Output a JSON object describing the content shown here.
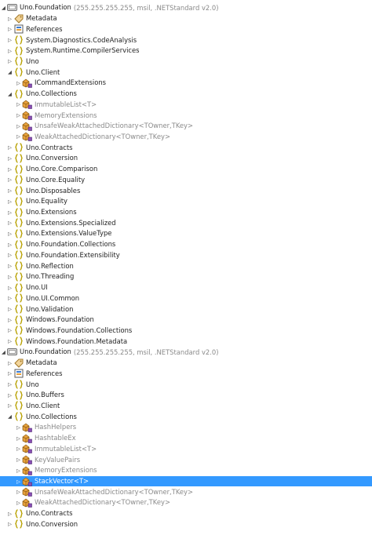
{
  "tree": [
    {
      "depth": 0,
      "expanded": true,
      "icon": "assembly-icon",
      "label": "Uno.Foundation",
      "sub": "(255.255.255.255, msil, .NETStandard v2.0)",
      "name": "assembly-uno-foundation"
    },
    {
      "depth": 1,
      "expanded": false,
      "icon": "metadata-icon",
      "label": "Metadata",
      "name": "node-metadata"
    },
    {
      "depth": 1,
      "expanded": false,
      "icon": "references-icon",
      "label": "References",
      "name": "node-references"
    },
    {
      "depth": 1,
      "expanded": false,
      "icon": "namespace-icon",
      "label": "System.Diagnostics.CodeAnalysis",
      "name": "ns-system-diagnostics-codeanalysis"
    },
    {
      "depth": 1,
      "expanded": false,
      "icon": "namespace-icon",
      "label": "System.Runtime.CompilerServices",
      "name": "ns-system-runtime-compilerservices"
    },
    {
      "depth": 1,
      "expanded": false,
      "icon": "namespace-icon",
      "label": "Uno",
      "name": "ns-uno"
    },
    {
      "depth": 1,
      "expanded": true,
      "icon": "namespace-icon",
      "label": "Uno.Client",
      "name": "ns-uno-client"
    },
    {
      "depth": 2,
      "expanded": false,
      "icon": "class-icon",
      "label": "ICommandExtensions",
      "name": "type-icommandextensions"
    },
    {
      "depth": 1,
      "expanded": true,
      "icon": "namespace-icon",
      "label": "Uno.Collections",
      "name": "ns-uno-collections"
    },
    {
      "depth": 2,
      "expanded": false,
      "icon": "class-icon",
      "label": "ImmutableList<T>",
      "gray": true,
      "name": "type-immutablelist"
    },
    {
      "depth": 2,
      "expanded": false,
      "icon": "class-icon",
      "label": "MemoryExtensions",
      "gray": true,
      "name": "type-memoryextensions"
    },
    {
      "depth": 2,
      "expanded": false,
      "icon": "class-icon",
      "label": "UnsafeWeakAttachedDictionary<TOwner,TKey>",
      "gray": true,
      "name": "type-unsafeweakattacheddictionary"
    },
    {
      "depth": 2,
      "expanded": false,
      "icon": "class-icon",
      "label": "WeakAttachedDictionary<TOwner,TKey>",
      "gray": true,
      "name": "type-weakattacheddictionary"
    },
    {
      "depth": 1,
      "expanded": false,
      "icon": "namespace-icon",
      "label": "Uno.Contracts",
      "name": "ns-uno-contracts"
    },
    {
      "depth": 1,
      "expanded": false,
      "icon": "namespace-icon",
      "label": "Uno.Conversion",
      "name": "ns-uno-conversion"
    },
    {
      "depth": 1,
      "expanded": false,
      "icon": "namespace-icon",
      "label": "Uno.Core.Comparison",
      "name": "ns-uno-core-comparison"
    },
    {
      "depth": 1,
      "expanded": false,
      "icon": "namespace-icon",
      "label": "Uno.Core.Equality",
      "name": "ns-uno-core-equality"
    },
    {
      "depth": 1,
      "expanded": false,
      "icon": "namespace-icon",
      "label": "Uno.Disposables",
      "name": "ns-uno-disposables"
    },
    {
      "depth": 1,
      "expanded": false,
      "icon": "namespace-icon",
      "label": "Uno.Equality",
      "name": "ns-uno-equality"
    },
    {
      "depth": 1,
      "expanded": false,
      "icon": "namespace-icon",
      "label": "Uno.Extensions",
      "name": "ns-uno-extensions"
    },
    {
      "depth": 1,
      "expanded": false,
      "icon": "namespace-icon",
      "label": "Uno.Extensions.Specialized",
      "name": "ns-uno-extensions-specialized"
    },
    {
      "depth": 1,
      "expanded": false,
      "icon": "namespace-icon",
      "label": "Uno.Extensions.ValueType",
      "name": "ns-uno-extensions-valuetype"
    },
    {
      "depth": 1,
      "expanded": false,
      "icon": "namespace-icon",
      "label": "Uno.Foundation.Collections",
      "name": "ns-uno-foundation-collections"
    },
    {
      "depth": 1,
      "expanded": false,
      "icon": "namespace-icon",
      "label": "Uno.Foundation.Extensibility",
      "name": "ns-uno-foundation-extensibility"
    },
    {
      "depth": 1,
      "expanded": false,
      "icon": "namespace-icon",
      "label": "Uno.Reflection",
      "name": "ns-uno-reflection"
    },
    {
      "depth": 1,
      "expanded": false,
      "icon": "namespace-icon",
      "label": "Uno.Threading",
      "name": "ns-uno-threading"
    },
    {
      "depth": 1,
      "expanded": false,
      "icon": "namespace-icon",
      "label": "Uno.UI",
      "name": "ns-uno-ui"
    },
    {
      "depth": 1,
      "expanded": false,
      "icon": "namespace-icon",
      "label": "Uno.UI.Common",
      "name": "ns-uno-ui-common"
    },
    {
      "depth": 1,
      "expanded": false,
      "icon": "namespace-icon",
      "label": "Uno.Validation",
      "name": "ns-uno-validation"
    },
    {
      "depth": 1,
      "expanded": false,
      "icon": "namespace-icon",
      "label": "Windows.Foundation",
      "name": "ns-windows-foundation"
    },
    {
      "depth": 1,
      "expanded": false,
      "icon": "namespace-icon",
      "label": "Windows.Foundation.Collections",
      "name": "ns-windows-foundation-collections"
    },
    {
      "depth": 1,
      "expanded": false,
      "icon": "namespace-icon",
      "label": "Windows.Foundation.Metadata",
      "name": "ns-windows-foundation-metadata"
    },
    {
      "depth": 0,
      "expanded": true,
      "icon": "assembly-icon",
      "label": "Uno.Foundation",
      "sub": "(255.255.255.255, msil, .NETStandard v2.0)",
      "name": "assembly-uno-foundation-2"
    },
    {
      "depth": 1,
      "expanded": false,
      "icon": "metadata-icon",
      "label": "Metadata",
      "name": "node-metadata-2"
    },
    {
      "depth": 1,
      "expanded": false,
      "icon": "references-icon",
      "label": "References",
      "name": "node-references-2"
    },
    {
      "depth": 1,
      "expanded": false,
      "icon": "namespace-icon",
      "label": "Uno",
      "name": "ns-uno-2"
    },
    {
      "depth": 1,
      "expanded": false,
      "icon": "namespace-icon",
      "label": "Uno.Buffers",
      "name": "ns-uno-buffers"
    },
    {
      "depth": 1,
      "expanded": false,
      "icon": "namespace-icon",
      "label": "Uno.Client",
      "name": "ns-uno-client-2"
    },
    {
      "depth": 1,
      "expanded": true,
      "icon": "namespace-icon",
      "label": "Uno.Collections",
      "name": "ns-uno-collections-2"
    },
    {
      "depth": 2,
      "expanded": false,
      "icon": "class-icon",
      "label": "HashHelpers",
      "gray": true,
      "name": "type-hashhelpers"
    },
    {
      "depth": 2,
      "expanded": false,
      "icon": "class-icon",
      "label": "HashtableEx",
      "gray": true,
      "name": "type-hashtableex"
    },
    {
      "depth": 2,
      "expanded": false,
      "icon": "class-icon",
      "label": "ImmutableList<T>",
      "gray": true,
      "name": "type-immutablelist-2"
    },
    {
      "depth": 2,
      "expanded": false,
      "icon": "class-icon",
      "label": "KeyValuePairs",
      "gray": true,
      "name": "type-keyvaluepairs"
    },
    {
      "depth": 2,
      "expanded": false,
      "icon": "class-icon",
      "label": "MemoryExtensions",
      "gray": true,
      "name": "type-memoryextensions-2"
    },
    {
      "depth": 2,
      "expanded": false,
      "icon": "class-icon",
      "label": "StackVector<T>",
      "selected": true,
      "name": "type-stackvector"
    },
    {
      "depth": 2,
      "expanded": false,
      "icon": "class-icon",
      "label": "UnsafeWeakAttachedDictionary<TOwner,TKey>",
      "gray": true,
      "name": "type-unsafeweakattacheddictionary-2"
    },
    {
      "depth": 2,
      "expanded": false,
      "icon": "class-icon",
      "label": "WeakAttachedDictionary<TOwner,TKey>",
      "gray": true,
      "name": "type-weakattacheddictionary-2"
    },
    {
      "depth": 1,
      "expanded": false,
      "icon": "namespace-icon",
      "label": "Uno.Contracts",
      "name": "ns-uno-contracts-2"
    },
    {
      "depth": 1,
      "expanded": false,
      "icon": "namespace-icon",
      "label": "Uno.Conversion",
      "name": "ns-uno-conversion-2"
    }
  ],
  "colors": {
    "selection": "#3399ff",
    "namespace_brace": "#d9c200",
    "class_orange": "#e8a13c",
    "class_purple": "#8a4fb4",
    "gray_text": "#8a8a8a"
  }
}
